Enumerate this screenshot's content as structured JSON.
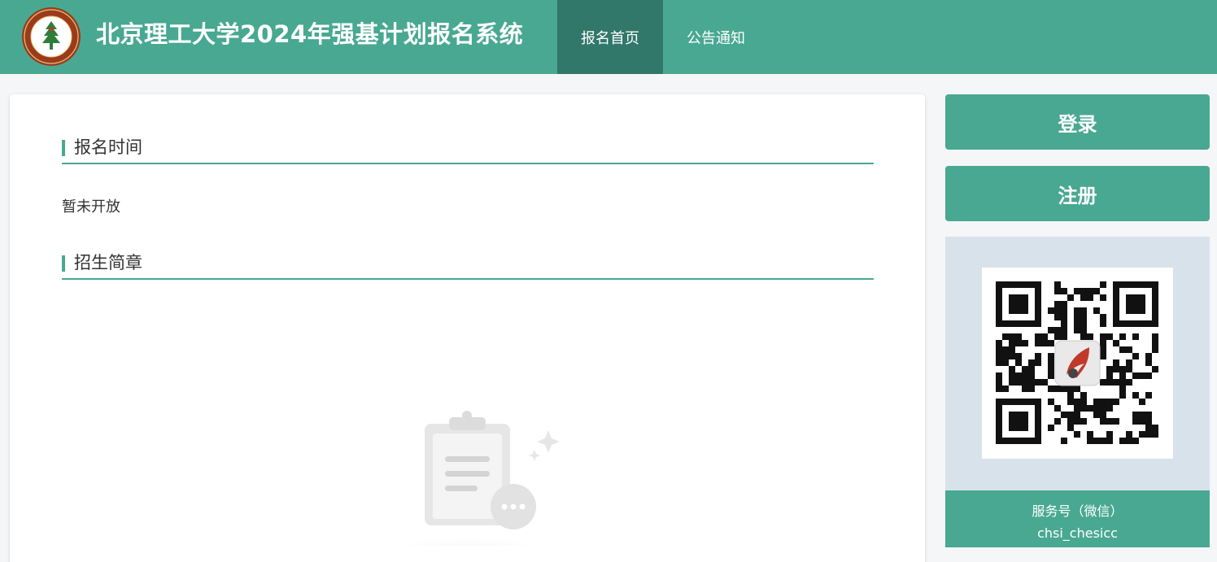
{
  "header": {
    "title": "北京理工大学2024年强基计划报名系统",
    "nav": [
      {
        "label": "报名首页",
        "active": true
      },
      {
        "label": "公告通知",
        "active": false
      }
    ]
  },
  "main": {
    "sections": [
      {
        "title": "报名时间"
      },
      {
        "title": "招生简章"
      }
    ],
    "registration_status": "暂未开放"
  },
  "sidebar": {
    "login_label": "登录",
    "register_label": "注册",
    "qr": {
      "caption_line1": "服务号（微信）",
      "caption_line2": "chsi_chesicc"
    }
  },
  "colors": {
    "primary": "#49a892",
    "primary_dark": "#31776a",
    "panel_bg": "#d8e2ea",
    "page_bg": "#f5f6f8"
  },
  "icons": [
    "university-logo-icon",
    "empty-clipboard-icon",
    "qr-code-icon"
  ]
}
